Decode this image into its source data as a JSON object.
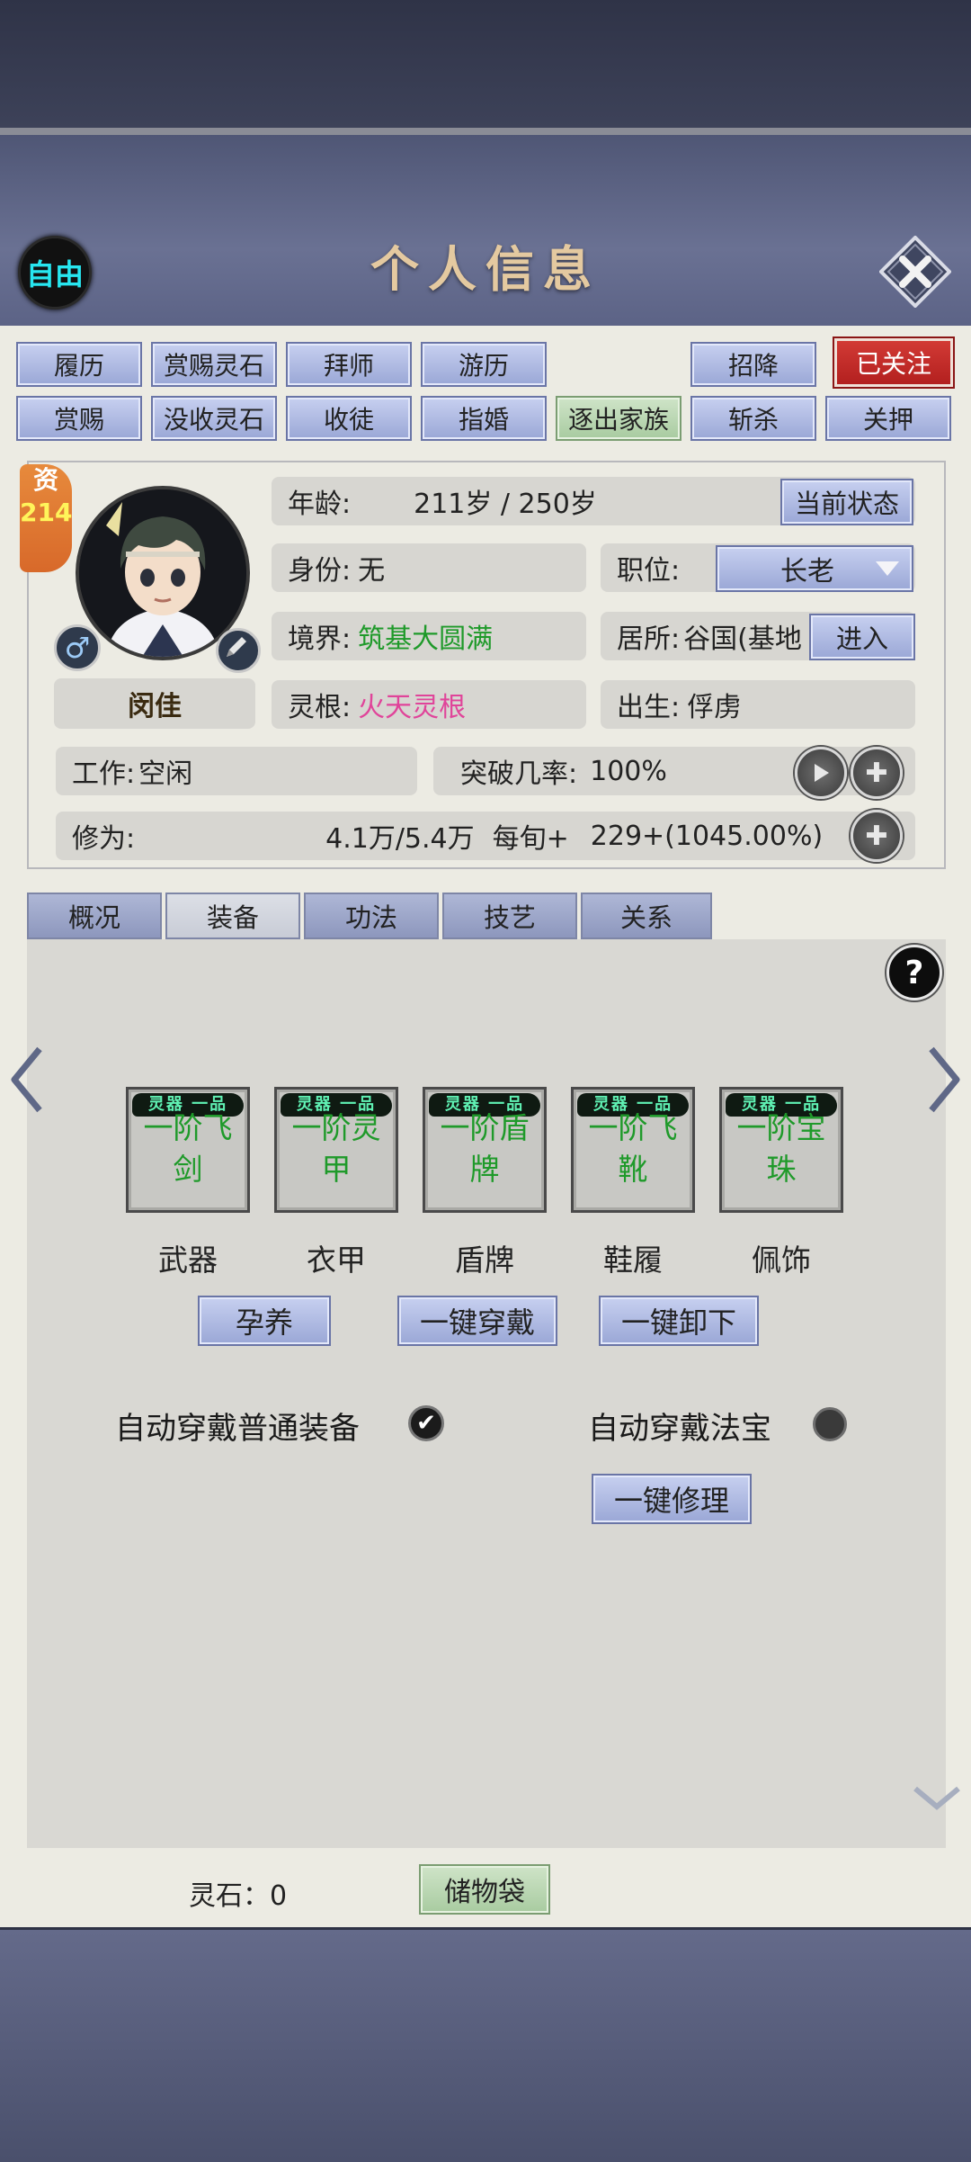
{
  "header": {
    "title": "个人信息",
    "free_badge": "自由",
    "close_icon": "close-icon"
  },
  "actions": {
    "row1": [
      "履历",
      "赏赐灵石",
      "拜师",
      "游历",
      "招降"
    ],
    "followed": "已关注",
    "row2": [
      "赏赐",
      "没收灵石",
      "收徒",
      "指婚",
      "逐出家族",
      "斩杀",
      "关押"
    ]
  },
  "profile": {
    "aptitude_label": "资",
    "aptitude_value": "214",
    "name": "闵佳",
    "age_label": "年龄:",
    "age_value": "211岁 / 250岁",
    "state_button": "当前状态",
    "identity_label": "身份:",
    "identity_value": "无",
    "position_label": "职位:",
    "position_value": "长老",
    "realm_label": "境界:",
    "realm_value": "筑基大圆满",
    "residence_label": "居所:",
    "residence_value": "谷国(基地",
    "enter_button": "进入",
    "root_label": "灵根:",
    "root_value": "火天灵根",
    "birth_label": "出生:",
    "birth_value": "俘虏",
    "work_label": "工作:",
    "work_value": "空闲",
    "breakthrough_label": "突破几率:",
    "breakthrough_value": "100%",
    "cultivation_label": "修为:",
    "cultivation_value": "4.1万/5.4万",
    "per_turn_label": "每旬+",
    "per_turn_value": "229+(1045.00%)"
  },
  "tabs": [
    "概况",
    "装备",
    "功法",
    "技艺",
    "关系"
  ],
  "active_tab": "装备",
  "equipment": {
    "slots": [
      {
        "tag": "灵器 一品",
        "line1": "一阶飞",
        "line2": "剑",
        "label": "武器"
      },
      {
        "tag": "灵器 一品",
        "line1": "一阶灵",
        "line2": "甲",
        "label": "衣甲"
      },
      {
        "tag": "灵器 一品",
        "line1": "一阶盾",
        "line2": "牌",
        "label": "盾牌"
      },
      {
        "tag": "灵器 一品",
        "line1": "一阶飞",
        "line2": "靴",
        "label": "鞋履"
      },
      {
        "tag": "灵器 一品",
        "line1": "一阶宝",
        "line2": "珠",
        "label": "佩饰"
      }
    ],
    "nurture": "孕养",
    "equip_all": "一键穿戴",
    "unequip_all": "一键卸下",
    "auto_normal": "自动穿戴普通装备",
    "auto_treasure": "自动穿戴法宝",
    "repair_all": "一键修理",
    "help": "?"
  },
  "footer": {
    "spirit_stone": "灵石：0",
    "storage_bag": "储物袋"
  },
  "colors": {
    "accent_blue": "#9aa7d6",
    "green_text": "#1f9a2a",
    "pink_text": "#e0449a",
    "followed_red": "#c22a28",
    "free_cyan": "#27e6f0"
  }
}
